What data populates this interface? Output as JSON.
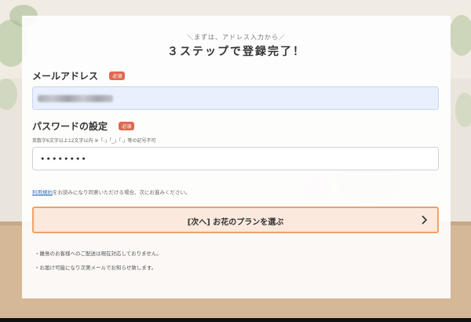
{
  "header": {
    "tagline": "＼まずは、アドレス入力から／",
    "title": "３ステップで登録完了！"
  },
  "email": {
    "label": "メールアドレス",
    "required_badge": "必須"
  },
  "password": {
    "label": "パスワードの設定",
    "required_badge": "必須",
    "hint": "英数字6文字以上12文字以内 ※「-」「_」「.」等の記号不可",
    "value": "••••••••"
  },
  "terms": {
    "link_text": "利用規約",
    "text": "をお読みになり同意いただける場合、次にお進みください。"
  },
  "next_button": {
    "label": "[次へ] お花のプランを選ぶ",
    "icon": "chevron-right-icon"
  },
  "notes": [
    "・離島のお客様へのご配送は現在対応しておりません。",
    "・お届け可能になり次第メールでお知らせ致します。"
  ],
  "colors": {
    "accent": "#f0a06a",
    "button_bg": "#fbe9dd",
    "badge": "#e3674f",
    "link": "#3a72c2"
  }
}
